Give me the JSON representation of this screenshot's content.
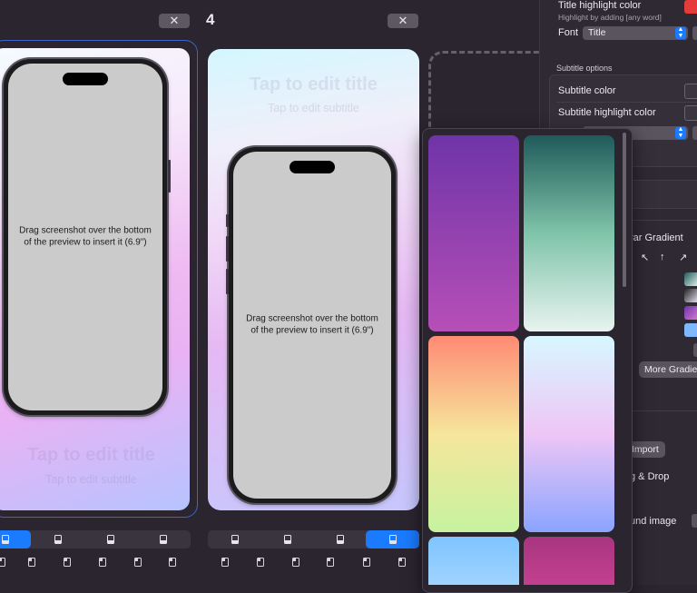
{
  "header": {
    "slide_number": "4",
    "close_glyph": "✕"
  },
  "slides": [
    {
      "title_placeholder": "Tap to edit title",
      "subtitle_placeholder": "Tap to edit subtitle",
      "drag_hint": "Drag screenshot over the bottom of the preview to insert it (6.9\")",
      "selected": true
    },
    {
      "title_placeholder": "Tap to edit title",
      "subtitle_placeholder": "Tap to edit subtitle",
      "drag_hint": "Drag screenshot over the bottom of the preview to insert it (6.9\")",
      "selected": false
    }
  ],
  "panel": {
    "title_highlight_color_label": "Title highlight color",
    "title_highlight_hint": "Highlight by adding [any word]",
    "font_label": "Font",
    "font_value": "Title",
    "subtitle_options_heading": "Subtitle options",
    "subtitle_color_label": "Subtitle color",
    "subtitle_highlight_color_label": "Subtitle highlight color",
    "gradient_type_value": "rar Gradient",
    "direction_arrows": [
      "↖",
      "↑",
      "↗"
    ],
    "more_gradients_label": "More Gradie",
    "import_label": "Import",
    "drag_drop_label": "g & Drop",
    "background_image_label": "und image"
  },
  "colors": {
    "accent": "#1a7bff",
    "title_highlight_swatch": "#e53b3b",
    "slide_border": "#3e63c9"
  },
  "gradients": [
    {
      "name": "purple",
      "from": "#6f34a8",
      "to": "#b74fb7"
    },
    {
      "name": "teal-mint",
      "from": "#1f5a5a",
      "to": "#e8f3f0"
    },
    {
      "name": "coral-lime",
      "from": "#ff8a74",
      "to": "#c6f3a0"
    },
    {
      "name": "ice-lilac",
      "from": "#d7f7ff",
      "to": "#8aa4ff"
    },
    {
      "name": "sky",
      "from": "#7fc4ff",
      "to": "#9fd3ff"
    },
    {
      "name": "magenta",
      "from": "#a8357f",
      "to": "#c2408f"
    }
  ]
}
